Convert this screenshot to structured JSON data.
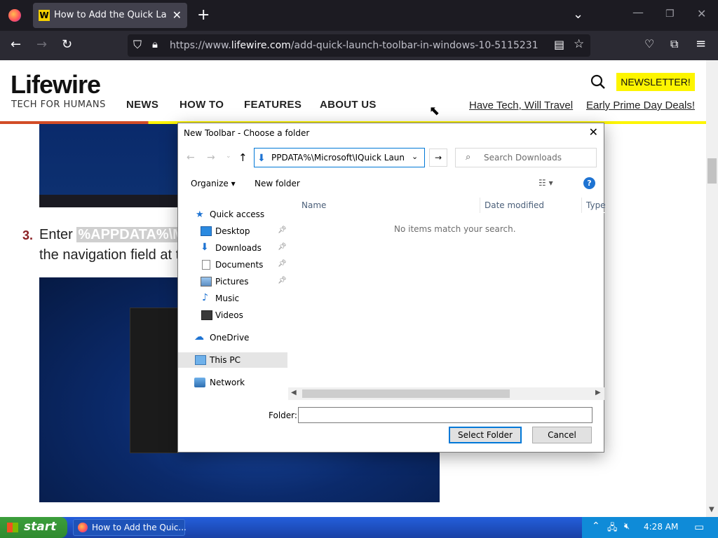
{
  "browser": {
    "tab_title": "How to Add the Quick Launch",
    "tab_favicon": "W",
    "new_tab": "+",
    "url_plain": "https://www.",
    "url_domain": "lifewire.com",
    "url_path": "/add-quick-launch-toolbar-in-windows-10-5115231"
  },
  "site": {
    "logo": "Lifewire",
    "tagline": "TECH FOR HUMANS",
    "nav": [
      "NEWS",
      "HOW TO",
      "FEATURES",
      "ABOUT US"
    ],
    "newsletter": "NEWSLETTER!",
    "promo": [
      "Have Tech, Will Travel",
      "Early Prime Day Deals!"
    ]
  },
  "article": {
    "step_number": "3.",
    "step_text_start": "Enter ",
    "step_highlight": "%APPDATA%\\M",
    "step_text_line2": "the navigation field at t"
  },
  "dialog": {
    "title": "New Toolbar - Choose a folder",
    "address": "PPDATA%\\Microsoft\\IQuick Launch\\",
    "search_placeholder": "Search Downloads",
    "organize": "Organize",
    "new_folder": "New folder",
    "nav_items": [
      {
        "label": "Quick access",
        "icon": "star-icon",
        "pinned": false
      },
      {
        "label": "Desktop",
        "icon": "desktop-icon",
        "pinned": true
      },
      {
        "label": "Downloads",
        "icon": "download-icon",
        "pinned": true
      },
      {
        "label": "Documents",
        "icon": "documents-icon",
        "pinned": true
      },
      {
        "label": "Pictures",
        "icon": "pictures-icon",
        "pinned": true
      },
      {
        "label": "Music",
        "icon": "music-icon",
        "pinned": false
      },
      {
        "label": "Videos",
        "icon": "videos-icon",
        "pinned": false
      },
      {
        "label": "OneDrive",
        "icon": "cloud-icon",
        "pinned": false
      },
      {
        "label": "This PC",
        "icon": "pc-icon",
        "pinned": false
      },
      {
        "label": "Network",
        "icon": "network-icon",
        "pinned": false
      }
    ],
    "columns": [
      "Name",
      "Date modified",
      "Type"
    ],
    "empty_message": "No items match your search.",
    "folder_label": "Folder:",
    "folder_value": "",
    "select_button": "Select Folder",
    "cancel_button": "Cancel"
  },
  "taskbar": {
    "start": "start",
    "task_title": "How to Add the Quic...",
    "clock": "4:28 AM"
  }
}
